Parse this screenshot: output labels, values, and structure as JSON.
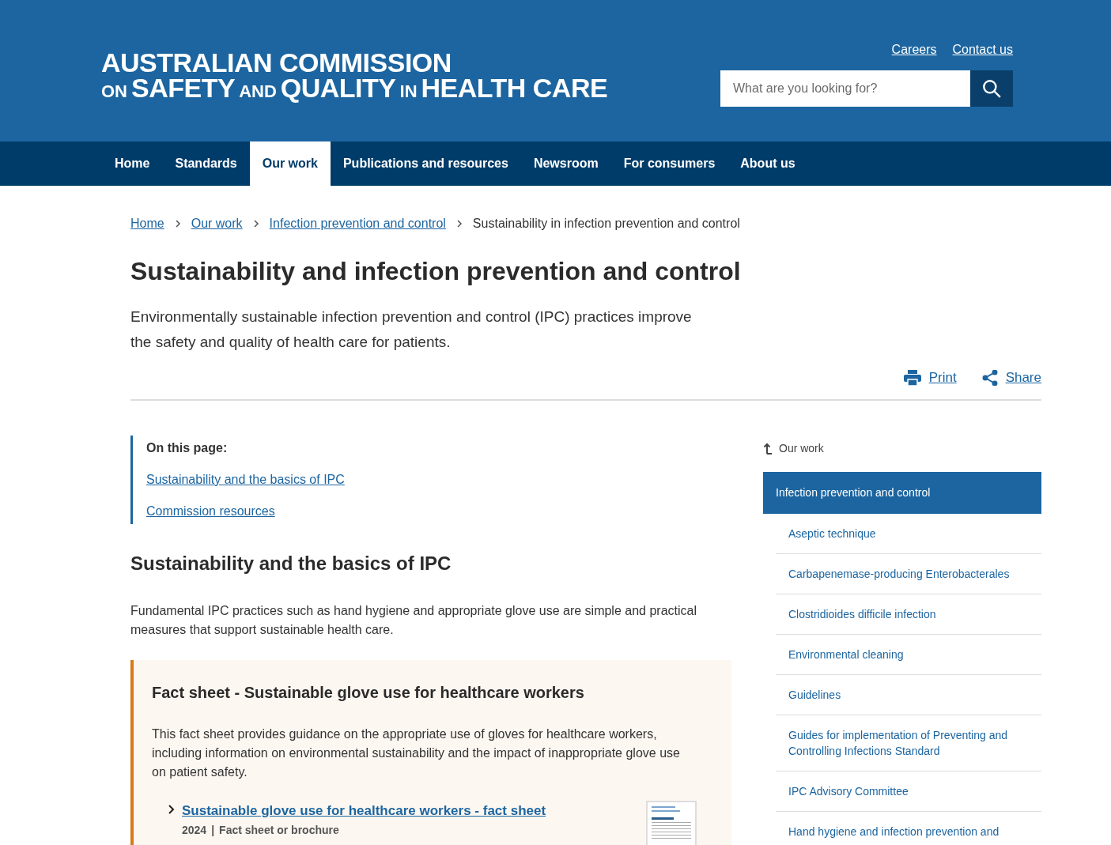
{
  "header": {
    "logo": {
      "line_1": "AUSTRALIAN COMMISSION",
      "line_2": [
        {
          "text": "ON",
          "kind": "small"
        },
        {
          "text": "SAFETY",
          "kind": "large"
        },
        {
          "text": "AND",
          "kind": "small"
        },
        {
          "text": "QUALITY",
          "kind": "large"
        },
        {
          "text": "IN",
          "kind": "small"
        },
        {
          "text": "HEALTH CARE",
          "kind": "large"
        }
      ]
    },
    "utility_links": [
      "Careers",
      "Contact us"
    ],
    "search": {
      "placeholder": "What are you looking for?"
    }
  },
  "nav": [
    {
      "label": "Home",
      "selected": false
    },
    {
      "label": "Standards",
      "selected": false
    },
    {
      "label": "Our work",
      "selected": true
    },
    {
      "label": "Publications and resources",
      "selected": false
    },
    {
      "label": "Newsroom",
      "selected": false
    },
    {
      "label": "For consumers",
      "selected": false
    },
    {
      "label": "About us",
      "selected": false
    }
  ],
  "breadcrumbs": [
    {
      "label": "Home",
      "link": true
    },
    {
      "label": "Our work",
      "link": true
    },
    {
      "label": "Infection prevention and control",
      "link": true
    },
    {
      "label": "Sustainability in infection prevention and control",
      "link": false
    }
  ],
  "page_title": "Sustainability and infection prevention and control",
  "intro": "Environmentally sustainable infection prevention and control (IPC) practices improve the safety and quality of health care for patients.",
  "actions": [
    {
      "kind": "print",
      "label": "Print"
    },
    {
      "kind": "share",
      "label": "Share"
    }
  ],
  "on_this_page": {
    "heading": "On this page:",
    "links": [
      "Sustainability and the basics of IPC",
      "Commission resources"
    ]
  },
  "section": {
    "heading": "Sustainability and the basics of IPC",
    "body": "Fundamental IPC practices such as hand hygiene and appropriate glove use are simple and practical measures that support sustainable health care."
  },
  "fact_card": {
    "title": "Fact sheet - Sustainable glove use for healthcare workers",
    "body": "This fact sheet provides guidance on the appropriate use of gloves for healthcare workers, including information on environmental sustainability and the impact of inappropriate glove use on patient safety.",
    "resource": {
      "link": "Sustainable glove use for healthcare workers - fact sheet",
      "year": "2024",
      "separator": "|",
      "type": "Fact sheet or brochure"
    }
  },
  "sidebar": {
    "parent": "Our work",
    "items": [
      {
        "label": "Infection prevention and control",
        "selected": true
      },
      {
        "label": "Aseptic technique",
        "selected": false
      },
      {
        "label": "Carbapenemase-producing Enterobacterales",
        "selected": false
      },
      {
        "label": "Clostridioides difficile infection",
        "selected": false
      },
      {
        "label": "Environmental cleaning",
        "selected": false
      },
      {
        "label": "Guidelines",
        "selected": false
      },
      {
        "label": "Guides for implementation of Preventing and Controlling Infections Standard",
        "selected": false
      },
      {
        "label": "IPC Advisory Committee",
        "selected": false
      },
      {
        "label": "Hand hygiene and infection prevention and",
        "selected": false
      }
    ]
  }
}
